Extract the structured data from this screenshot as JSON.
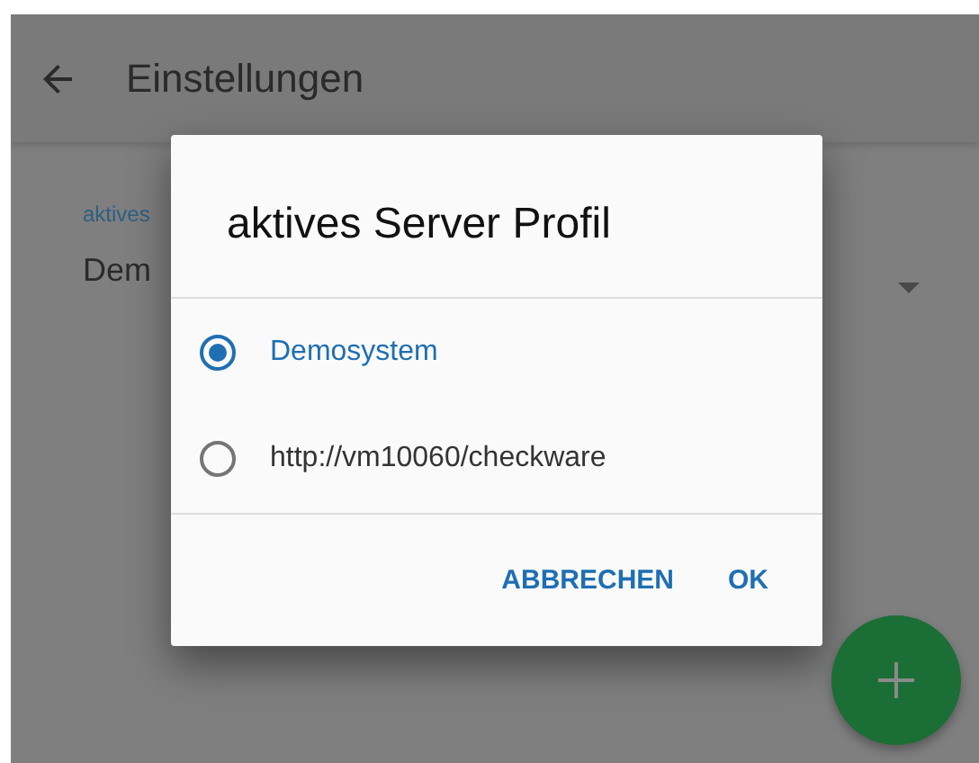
{
  "app_bar": {
    "title": "Einstellungen"
  },
  "setting": {
    "label": "aktives",
    "value": "Dem"
  },
  "dialog": {
    "title": "aktives Server Profil",
    "options": [
      {
        "label": "Demosystem",
        "selected": true
      },
      {
        "label": "http://vm10060/checkware",
        "selected": false
      }
    ],
    "buttons": [
      "ABBRECHEN",
      "OK"
    ]
  }
}
